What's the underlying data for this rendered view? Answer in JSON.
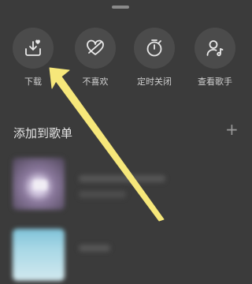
{
  "actions": [
    {
      "label": "下载",
      "icon": "download-icon"
    },
    {
      "label": "不喜欢",
      "icon": "dislike-heart-icon"
    },
    {
      "label": "定时关闭",
      "icon": "timer-icon"
    },
    {
      "label": "查看歌手",
      "icon": "artist-icon"
    }
  ],
  "section": {
    "title": "添加到歌单",
    "add_symbol": "+"
  },
  "colors": {
    "background": "#3b3b3b",
    "button": "#4b4b4b",
    "arrow": "#f6e77a"
  }
}
